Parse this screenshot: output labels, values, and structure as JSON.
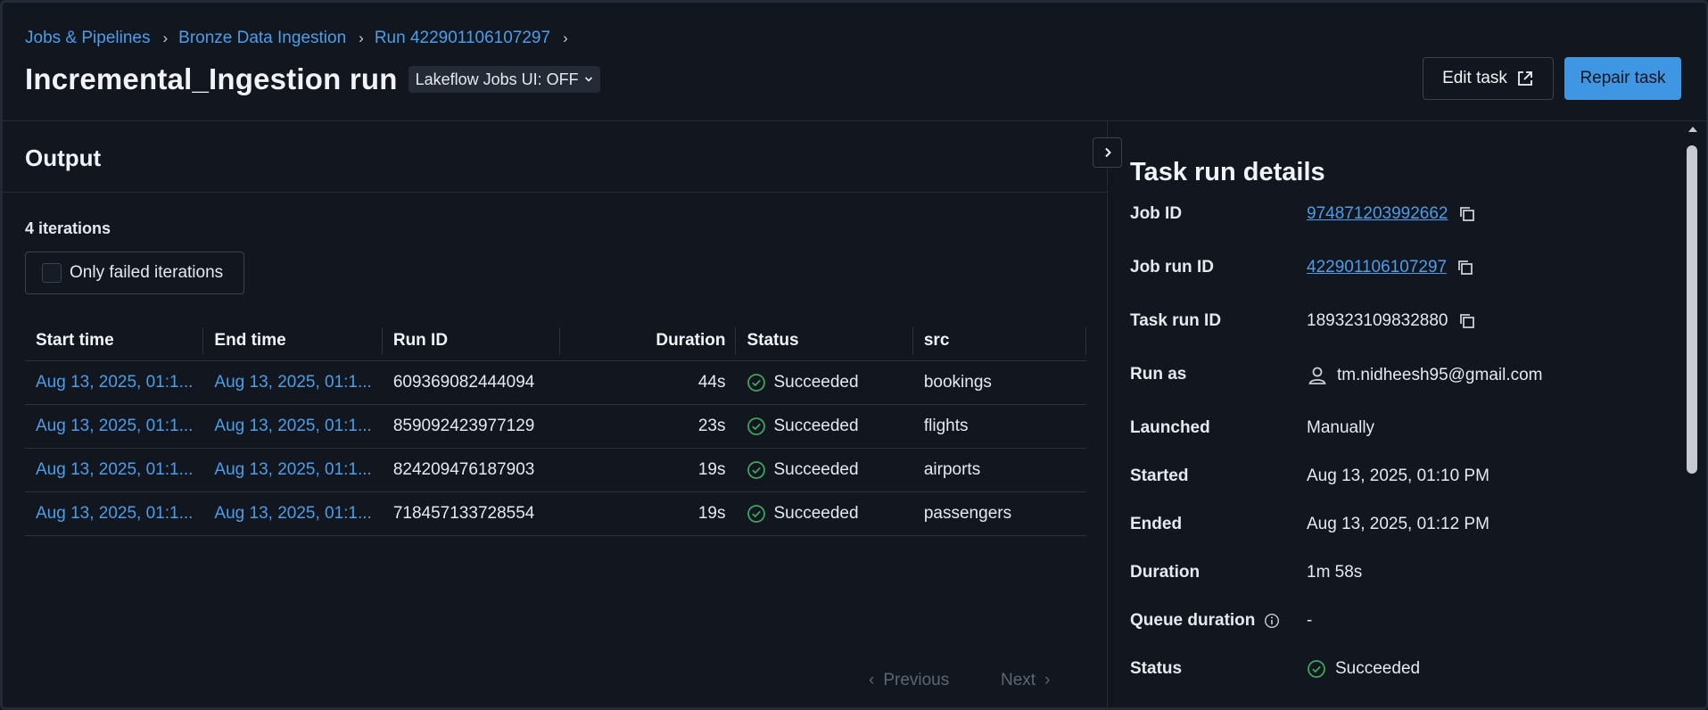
{
  "breadcrumb": {
    "items": [
      "Jobs & Pipelines",
      "Bronze Data Ingestion",
      "Run 422901106107297"
    ]
  },
  "header": {
    "title": "Incremental_Ingestion run",
    "ui_toggle": "Lakeflow Jobs UI: OFF",
    "edit_task": "Edit task",
    "repair_task": "Repair task"
  },
  "output": {
    "title": "Output",
    "iterations": "4 iterations",
    "filter_label": "Only failed iterations",
    "columns": [
      "Start time",
      "End time",
      "Run ID",
      "Duration",
      "Status",
      "src"
    ],
    "rows": [
      {
        "start": "Aug 13, 2025, 01:1...",
        "end": "Aug 13, 2025, 01:1...",
        "run_id": "609369082444094",
        "duration": "44s",
        "status": "Succeeded",
        "src": "bookings"
      },
      {
        "start": "Aug 13, 2025, 01:1...",
        "end": "Aug 13, 2025, 01:1...",
        "run_id": "859092423977129",
        "duration": "23s",
        "status": "Succeeded",
        "src": "flights"
      },
      {
        "start": "Aug 13, 2025, 01:1...",
        "end": "Aug 13, 2025, 01:1...",
        "run_id": "824209476187903",
        "duration": "19s",
        "status": "Succeeded",
        "src": "airports"
      },
      {
        "start": "Aug 13, 2025, 01:1...",
        "end": "Aug 13, 2025, 01:1...",
        "run_id": "718457133728554",
        "duration": "19s",
        "status": "Succeeded",
        "src": "passengers"
      }
    ],
    "pager_previous": "Previous",
    "pager_next": "Next"
  },
  "details": {
    "title": "Task run details",
    "job_id_label": "Job ID",
    "job_id": "974871203992662",
    "job_run_id_label": "Job run ID",
    "job_run_id": "422901106107297",
    "task_run_id_label": "Task run ID",
    "task_run_id": "189323109832880",
    "run_as_label": "Run as",
    "run_as": "tm.nidheesh95@gmail.com",
    "launched_label": "Launched",
    "launched": "Manually",
    "started_label": "Started",
    "started": "Aug 13, 2025, 01:10 PM",
    "ended_label": "Ended",
    "ended": "Aug 13, 2025, 01:12 PM",
    "duration_label": "Duration",
    "duration": "1m 58s",
    "queue_label": "Queue duration",
    "queue": "-",
    "status_label": "Status",
    "status": "Succeeded"
  },
  "colors": {
    "accent": "#4c9ee8",
    "primary_button": "#3f96e3",
    "success": "#3fa55c",
    "background": "#11161f"
  }
}
